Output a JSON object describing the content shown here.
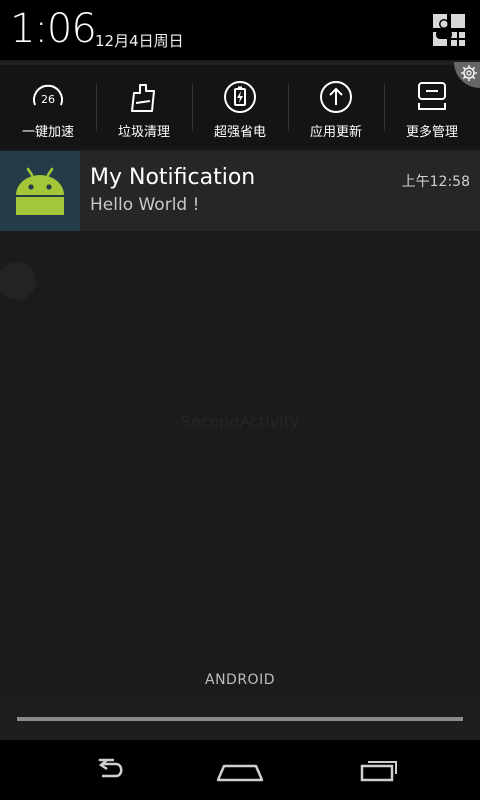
{
  "status_bar": {
    "time": "1:06",
    "date": "12月4日周日",
    "profile_icon": "user-grid-icon"
  },
  "quick_settings": {
    "settings_icon": "gear-icon",
    "items": [
      {
        "label": "一键加速",
        "icon": "speed-gauge-icon",
        "badge": "26"
      },
      {
        "label": "垃圾清理",
        "icon": "broom-icon"
      },
      {
        "label": "超强省电",
        "icon": "battery-icon"
      },
      {
        "label": "应用更新",
        "icon": "upload-arrow-icon"
      },
      {
        "label": "更多管理",
        "icon": "manage-box-icon"
      }
    ]
  },
  "notification": {
    "icon": "android-icon",
    "title": "My Notification",
    "text": "Hello World !",
    "time": "上午12:58"
  },
  "background": {
    "activity_text": "SecondActivity"
  },
  "carrier": "ANDROID",
  "nav": {
    "back_icon": "back-arrow-icon",
    "home_icon": "home-icon",
    "recents_icon": "recents-icon"
  }
}
